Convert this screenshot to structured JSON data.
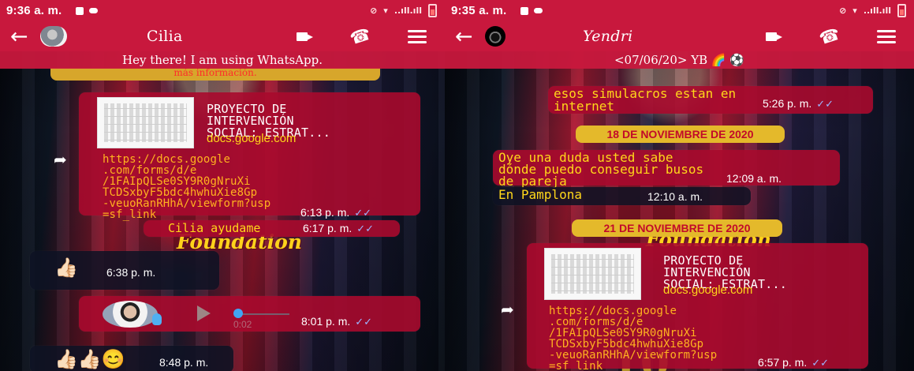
{
  "left_screen": {
    "status": {
      "time": "9:36 a. m.",
      "signal_text": "..ıll.ıll"
    },
    "header": {
      "contact_name": "Cilia"
    },
    "about": "Hey there! I am using WhatsApp.",
    "top_pill": "más información.",
    "link_message": {
      "preview_title": "PROYECTO DE\nINTERVENCIÓN\nSOCIAL: ESTRAT...",
      "domain": "docs.google.com",
      "url": "https://docs.google\n.com/forms/d/e\n/1FAIpQLSe0SY9R0gNruXi\nTCDSxbyF5bdc4hwhuXie8Gp\n-veuoRanRHhA/viewform?usp\n=sf_link",
      "time": "6:13 p. m."
    },
    "outgoing_text": {
      "text": "Cilia ayudame",
      "time": "6:17 p. m."
    },
    "emoji_message_1": {
      "emoji": "👍🏻",
      "time": "6:38 p. m."
    },
    "voice_message": {
      "duration": "0:02",
      "time": "8:01 p. m."
    },
    "emoji_message_2": {
      "emoji": "👍🏻👍🏻😊",
      "time": "8:48 p. m."
    },
    "background_text": "Foundation"
  },
  "right_screen": {
    "status": {
      "time": "9:35 a. m.",
      "signal_text": "..ıll.ıll"
    },
    "header": {
      "contact_name": "Yendri"
    },
    "about": "<07/06/20> YB 🌈 ⚽",
    "messages": {
      "first": {
        "text": "esos simulacros estan en\ninternet",
        "time": "5:26 p. m."
      },
      "date_1": "18 DE NOVIEMBRE DE 2020",
      "question": {
        "text": "Oye una duda usted sabe\ndónde puedo conseguir busos\nde pareja",
        "time": "12:09 a. m."
      },
      "location": {
        "text": "En Pamplona",
        "time": "12:10 a. m."
      },
      "date_2": "21 DE NOVIEMBRE DE 2020",
      "link_message": {
        "preview_title": "PROYECTO DE\nINTERVENCIÓN\nSOCIAL: ESTRAT...",
        "domain": "docs.google.com",
        "url": "https://docs.google\n.com/forms/d/e\n/1FAIpQLSe0SY9R0gNruXi\nTCDSxbyF5bdc4hwhuXie8Gp\n-veuoRanRHhA/viewform?usp\n=sf_link",
        "time": "6:57 p. m."
      }
    },
    "background_text": "Foundation"
  },
  "icons": {
    "back": "←",
    "phone": "☎",
    "forward": "➦",
    "check": "✓✓"
  },
  "colors": {
    "header_red": "#c8183d",
    "bubble_red": "#a90a2d",
    "text_yellow": "#ffd71a",
    "date_gold": "#e4b92b"
  }
}
